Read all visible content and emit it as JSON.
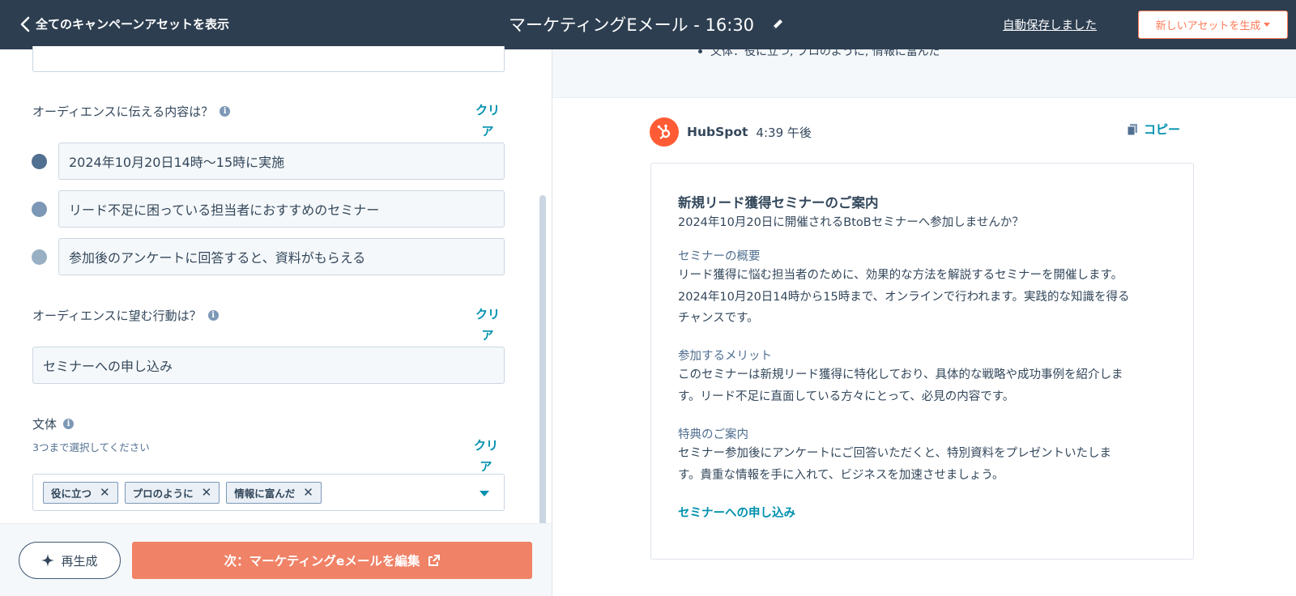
{
  "header": {
    "back_label": "全てのキャンペーンアセットを表示",
    "title": "マーケティングEメール - 16:30",
    "autosave": "自動保存しました",
    "generate_button": "新しいアセットを生成"
  },
  "form": {
    "audience_message": {
      "label": "オーディエンスに伝える内容は？",
      "clear_label": "クリア",
      "items": [
        {
          "value": "2024年10月20日14時〜15時に実施",
          "color": "#516f90"
        },
        {
          "value": "リード不足に困っている担当者におすすめのセミナー",
          "color": "#7c98b6"
        },
        {
          "value": "参加後のアンケートに回答すると、資料がもらえる",
          "color": "#99afc4"
        }
      ]
    },
    "audience_action": {
      "label": "オーディエンスに望む行動は？",
      "clear_label": "クリア",
      "value": "セミナーへの申し込み"
    },
    "tone": {
      "label": "文体",
      "hint": "3つまで選択してください",
      "clear_label": "クリア",
      "tags": [
        "役に立つ",
        "プロのように",
        "情報に富んだ"
      ]
    }
  },
  "footer": {
    "regenerate_label": "再生成",
    "next_label": "次：マーケティングeメールを編集"
  },
  "preview": {
    "previous_line": "文体：役に立つ, プロのように, 情報に富んだ",
    "sender": "HubSpot",
    "time": "4:39 午後",
    "copy_label": "コピー",
    "email": {
      "title": "新規リード獲得セミナーのご案内",
      "subtitle": "2024年10月20日に開催されるBtoBセミナーへ参加しませんか？",
      "sections": [
        {
          "heading": "セミナーの概要",
          "lines": [
            "リード獲得に悩む担当者のために、効果的な方法を解説するセミナーを開催します。",
            "2024年10月20日14時から15時まで、オンラインで行われます。実践的な知識を得る",
            "チャンスです。"
          ]
        },
        {
          "heading": "参加するメリット",
          "lines": [
            "このセミナーは新規リード獲得に特化しており、具体的な戦略や成功事例を紹介しま",
            "す。リード不足に直面している方々にとって、必見の内容です。"
          ]
        },
        {
          "heading": "特典のご案内",
          "lines": [
            "セミナー参加後にアンケートにご回答いただくと、特別資料をプレゼントいたしま",
            "す。貴重な情報を手に入れて、ビジネスを加速させましょう。"
          ]
        }
      ],
      "cta": "セミナーへの申し込み"
    }
  },
  "colors": {
    "header_bg": "#2d3e50",
    "accent": "#ff7a59",
    "link": "#0091ae"
  }
}
